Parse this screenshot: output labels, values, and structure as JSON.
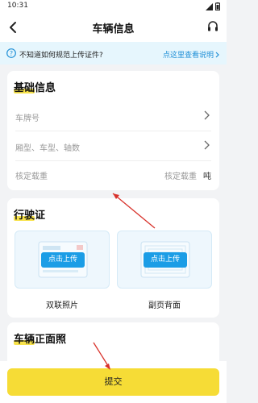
{
  "status_bar": {
    "time": "10:31"
  },
  "nav": {
    "title": "车辆信息"
  },
  "notice": {
    "text": "不知道如何规范上传证件?",
    "link": "点这里查看说明"
  },
  "basic_info": {
    "title": "基础信息",
    "rows": [
      {
        "label": "车牌号"
      },
      {
        "label": "厢型、车型、轴数"
      },
      {
        "label": "核定载重",
        "placeholder": "核定载重",
        "unit": "吨"
      }
    ]
  },
  "license": {
    "title": "行驶证",
    "uploads": [
      {
        "button": "点击上传",
        "caption": "双联照片"
      },
      {
        "button": "点击上传",
        "caption": "副页背面"
      }
    ]
  },
  "front_photo": {
    "title": "车辆正面照"
  },
  "footer": {
    "submit": "提交"
  },
  "colors": {
    "accent": "#1b9de6",
    "button": "#f6dc36",
    "highlight": "#f7e24a",
    "arrow": "#d8322b"
  }
}
